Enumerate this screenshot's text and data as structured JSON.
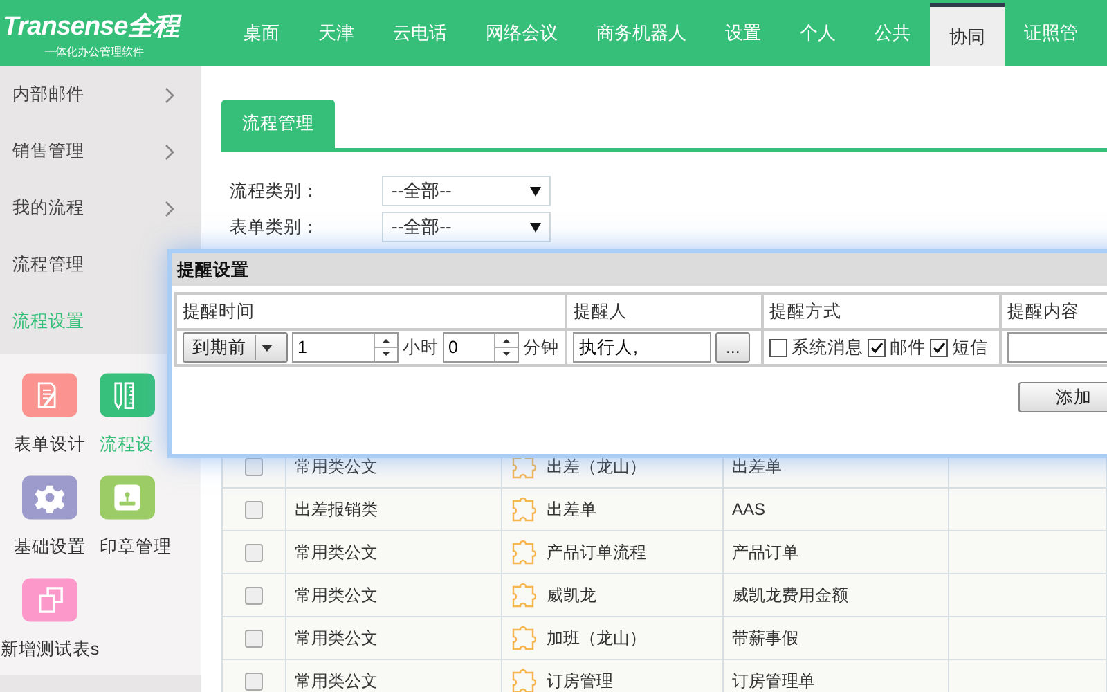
{
  "logo": {
    "title": "Transense全程",
    "subtitle": "一体化办公管理软件"
  },
  "nav": [
    {
      "label": "桌面",
      "selected": false
    },
    {
      "label": "天津",
      "selected": false
    },
    {
      "label": "云电话",
      "selected": false
    },
    {
      "label": "网络会议",
      "selected": false
    },
    {
      "label": "商务机器人",
      "selected": false
    },
    {
      "label": "设置",
      "selected": false
    },
    {
      "label": "个人",
      "selected": false
    },
    {
      "label": "公共",
      "selected": false
    },
    {
      "label": "协同",
      "selected": true
    },
    {
      "label": "证照管",
      "selected": false
    }
  ],
  "sidebar": {
    "items": [
      {
        "label": "内部邮件",
        "selected": false,
        "arrow": true
      },
      {
        "label": "销售管理",
        "selected": false,
        "arrow": true
      },
      {
        "label": "我的流程",
        "selected": false,
        "arrow": true
      },
      {
        "label": "流程管理",
        "selected": false,
        "arrow": false
      },
      {
        "label": "流程设置",
        "selected": true,
        "arrow": false
      }
    ],
    "tiles": [
      {
        "label": "表单设计",
        "kind": "form",
        "color": "#fb9390",
        "selected": false
      },
      {
        "label": "流程设",
        "kind": "ruler",
        "color": "#36c07b",
        "selected": true
      },
      {
        "label": "基础设置",
        "kind": "gear",
        "color": "#9d9bcc",
        "selected": false
      },
      {
        "label": "印章管理",
        "kind": "stamp",
        "color": "#9bcc65",
        "selected": false
      },
      {
        "label": "新增测试表s",
        "kind": "squares",
        "color": "#fd98cb",
        "selected": false
      }
    ]
  },
  "tab": "流程管理",
  "filters": [
    {
      "label": "流程类别：",
      "value": "--全部--"
    },
    {
      "label": "表单类别：",
      "value": "--全部--"
    }
  ],
  "table": {
    "rows": [
      {
        "checked": false,
        "category": "常用类公文",
        "flow": "出差（龙山）",
        "form": "出差单"
      },
      {
        "checked": false,
        "category": "出差报销类",
        "flow": "出差单",
        "form": "AAS"
      },
      {
        "checked": false,
        "category": "常用类公文",
        "flow": "产品订单流程",
        "form": "产品订单"
      },
      {
        "checked": false,
        "category": "常用类公文",
        "flow": "威凯龙",
        "form": "威凯龙费用金额"
      },
      {
        "checked": false,
        "category": "常用类公文",
        "flow": "加班（龙山）",
        "form": "带薪事假"
      },
      {
        "checked": false,
        "category": "常用类公文",
        "flow": "订房管理",
        "form": "订房管理单"
      }
    ]
  },
  "dialog": {
    "title": "提醒设置",
    "columns": [
      "提醒时间",
      "提醒人",
      "提醒方式",
      "提醒内容"
    ],
    "when": "到期前",
    "hours": "1",
    "hours_unit": "小时",
    "minutes": "0",
    "minutes_unit": "分钟",
    "person": "执行人,",
    "browse": "...",
    "methods": [
      {
        "label": "系统消息",
        "checked": false
      },
      {
        "label": "邮件",
        "checked": true
      },
      {
        "label": "短信",
        "checked": true
      }
    ],
    "add": "添加"
  }
}
